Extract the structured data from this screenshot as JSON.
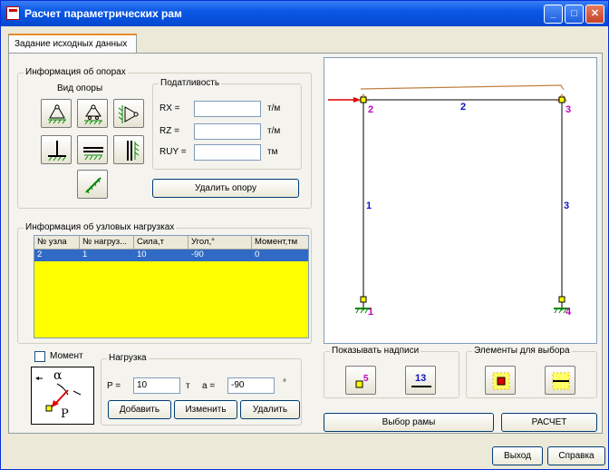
{
  "window": {
    "title": "Расчет параметрических рам"
  },
  "tabs": [
    {
      "label": "Задание исходных данных"
    }
  ],
  "supports_group": {
    "title": "Информация об опорах",
    "type_label": "Вид опоры",
    "compliance_title": "Податливость",
    "fields": [
      {
        "label": "RX  =",
        "value": "",
        "unit": "т/м"
      },
      {
        "label": "RZ  =",
        "value": "",
        "unit": "т/м"
      },
      {
        "label": "RUY =",
        "value": "",
        "unit": "тм"
      }
    ],
    "delete_button": "Удалить опору"
  },
  "loads_group": {
    "title": "Информация об узловых нагрузках",
    "columns": [
      "№ узла",
      "№ нагруз...",
      "Сила,т",
      "Угол,°",
      "Момент,тм"
    ],
    "rows": [
      [
        "2",
        "1",
        "10",
        "-90",
        "0"
      ]
    ]
  },
  "load_editor": {
    "moment_label": "Момент",
    "moment_checked": false,
    "title": "Нагрузка",
    "p_label": "P =",
    "p_value": "10",
    "p_unit": "т",
    "a_label": "a =",
    "a_value": "-90",
    "a_unit": "°",
    "add_button": "Добавить",
    "change_button": "Изменить",
    "delete_button": "Удалить",
    "alpha_symbol": "α",
    "p_symbol": "P"
  },
  "frame_view": {
    "node_labels": [
      "2",
      "3",
      "1",
      "4"
    ],
    "element_labels": [
      "2",
      "1",
      "3"
    ]
  },
  "show_labels": {
    "title": "Показывать надписи",
    "nodes_num": "5",
    "elements_num": "13"
  },
  "select_elements": {
    "title": "Элементы для выбора"
  },
  "actions": {
    "select_frame": "Выбор рамы",
    "calculate": "РАСЧЕТ",
    "exit": "Выход",
    "help": "Справка"
  },
  "colors": {
    "title_bar": "#0a58e6",
    "selection": "#316ac5",
    "table_bg": "#ffff00",
    "load_arrow": "#e00000",
    "frame_line": "#000000",
    "deformed_line": "#c08040"
  }
}
